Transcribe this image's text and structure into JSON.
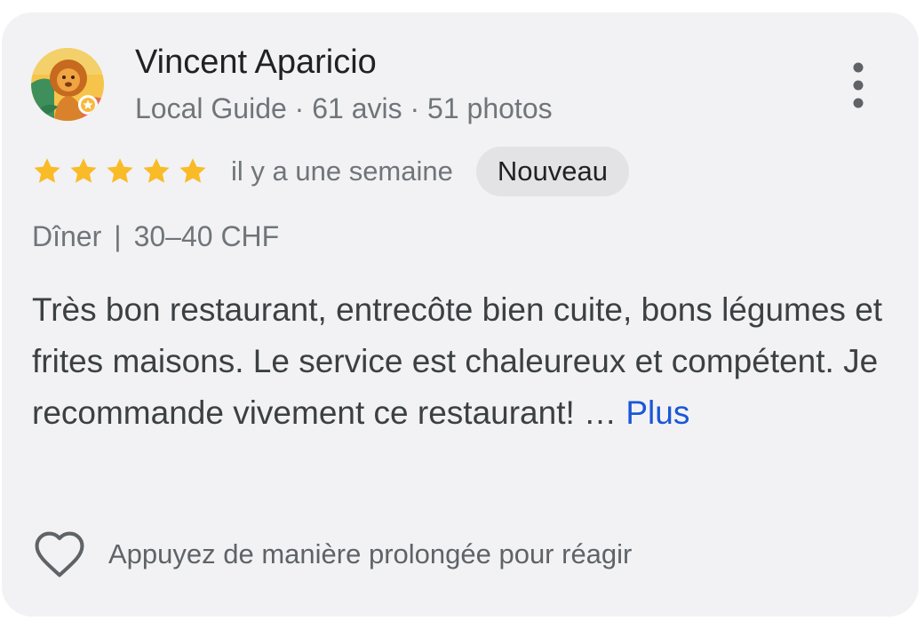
{
  "review": {
    "author": "Vincent Aparicio",
    "author_meta": "Local Guide · 61 avis · 51 photos",
    "rating": 5,
    "rating_max": 5,
    "date": "il y a une semaine",
    "badge": "Nouveau",
    "meal": "Dîner",
    "separator": "|",
    "price": "30–40 CHF",
    "text": "Très bon restaurant, entrecôte bien cuite, bons légumes et frites maisons. Le service est chaleureux et compétent. Je recommande vivement ce restaurant! …",
    "more_label": "Plus",
    "react_label": "Appuyez de manière prolongée pour réagir"
  },
  "icons": {
    "avatar": "lion-avatar-icon",
    "star": "star-icon",
    "menu": "more-vert-icon",
    "react": "heart-outline-icon"
  },
  "colors": {
    "card_background": "#f2f2f4",
    "star": "#f9bb27",
    "link": "#1a57d6",
    "badge_background": "#e3e3e5"
  }
}
